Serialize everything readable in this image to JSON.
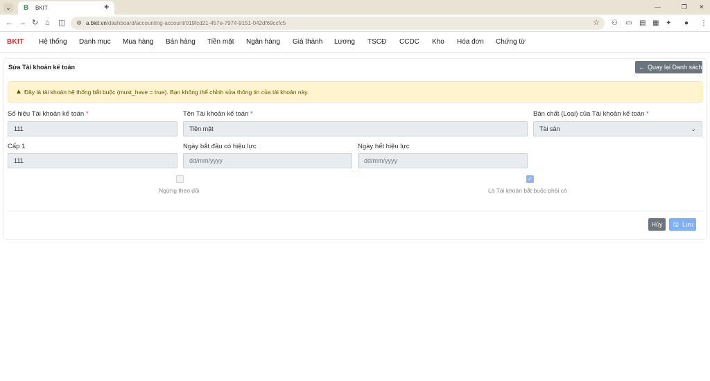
{
  "browser": {
    "tab_title": "BKIT",
    "tab_favicon": "B",
    "url_domain": "a.bkit.vn",
    "url_path": "/dashboard/accounting-account/019fcd21-457e-7974-9151-042df69ccfc5"
  },
  "navbar": {
    "brand": "BKIT",
    "items": [
      "Hệ thống",
      "Danh mục",
      "Mua hàng",
      "Bán hàng",
      "Tiền mặt",
      "Ngân hàng",
      "Giá thành",
      "Lương",
      "TSCĐ",
      "CCDC",
      "Kho",
      "Hóa đơn",
      "Chứng từ"
    ]
  },
  "page": {
    "title": "Sửa Tài khoản kế toán",
    "back_button": "Quay lại Danh sách",
    "alert": "Đây là tài khoản hệ thống bắt buộc (must_have = true). Bạn không thể chỉnh sửa thông tin của tài khoản này."
  },
  "form": {
    "account_number": {
      "label": "Số hiệu Tài khoản kế toán",
      "required": "*",
      "value": "111"
    },
    "account_name": {
      "label": "Tên Tài khoản kế toán",
      "required": "*",
      "value": "Tiền mặt"
    },
    "account_nature": {
      "label": "Bản chất (Loại) của Tài khoản kế toán",
      "required": "*",
      "value": "Tài sản"
    },
    "level": {
      "label": "Cấp 1",
      "value": "111"
    },
    "effective_start": {
      "label": "Ngày bắt đầu có hiệu lực",
      "placeholder": "dd/mm/yyyy"
    },
    "effective_end": {
      "label": "Ngày hết hiệu lực",
      "placeholder": "dd/mm/yyyy"
    },
    "stop_tracking": {
      "label": "Ngừng theo dõi",
      "checked": false
    },
    "mandatory": {
      "label": "Là Tài khoản bắt buộc phải có",
      "checked": true
    }
  },
  "actions": {
    "cancel": "Hủy",
    "save": "Lưu"
  },
  "colors": {
    "brand": "#e4262c",
    "alert_bg": "#fff4cd",
    "secondary_button": "#6c757d",
    "primary_button": "#7fb0f5"
  }
}
